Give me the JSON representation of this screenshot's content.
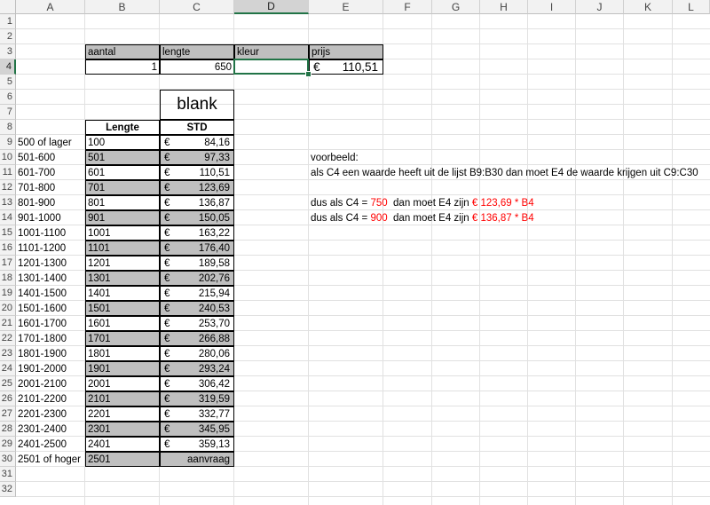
{
  "columns": [
    "A",
    "B",
    "C",
    "D",
    "E",
    "F",
    "G",
    "H",
    "I",
    "J",
    "K",
    "L"
  ],
  "selected_column": "D",
  "selected_row": 4,
  "header_row": {
    "aantal": "aantal",
    "lengte": "lengte",
    "kleur": "kleur",
    "prijs": "prijs"
  },
  "input_row": {
    "aantal_value": "1",
    "lengte_value": "650",
    "kleur_value": "",
    "prijs_currency": "€",
    "prijs_value": "110,51"
  },
  "table": {
    "blank_label": "blank",
    "lengte_header": "Lengte",
    "std_header": "STD",
    "currency": "€",
    "rows": [
      {
        "range": "500 of lager",
        "lengte": "100",
        "std": "84,16"
      },
      {
        "range": "501-600",
        "lengte": "501",
        "std": "97,33"
      },
      {
        "range": "601-700",
        "lengte": "601",
        "std": "110,51"
      },
      {
        "range": "701-800",
        "lengte": "701",
        "std": "123,69"
      },
      {
        "range": "801-900",
        "lengte": "801",
        "std": "136,87"
      },
      {
        "range": "901-1000",
        "lengte": "901",
        "std": "150,05"
      },
      {
        "range": "1001-1100",
        "lengte": "1001",
        "std": "163,22"
      },
      {
        "range": "1101-1200",
        "lengte": "1101",
        "std": "176,40"
      },
      {
        "range": "1201-1300",
        "lengte": "1201",
        "std": "189,58"
      },
      {
        "range": "1301-1400",
        "lengte": "1301",
        "std": "202,76"
      },
      {
        "range": "1401-1500",
        "lengte": "1401",
        "std": "215,94"
      },
      {
        "range": "1501-1600",
        "lengte": "1501",
        "std": "240,53"
      },
      {
        "range": "1601-1700",
        "lengte": "1601",
        "std": "253,70"
      },
      {
        "range": "1701-1800",
        "lengte": "1701",
        "std": "266,88"
      },
      {
        "range": "1801-1900",
        "lengte": "1801",
        "std": "280,06"
      },
      {
        "range": "1901-2000",
        "lengte": "1901",
        "std": "293,24"
      },
      {
        "range": "2001-2100",
        "lengte": "2001",
        "std": "306,42"
      },
      {
        "range": "2101-2200",
        "lengte": "2101",
        "std": "319,59"
      },
      {
        "range": "2201-2300",
        "lengte": "2201",
        "std": "332,77"
      },
      {
        "range": "2301-2400",
        "lengte": "2301",
        "std": "345,95"
      },
      {
        "range": "2401-2500",
        "lengte": "2401",
        "std": "359,13"
      },
      {
        "range": "2501 of hoger",
        "lengte": "2501",
        "std": "aanvraag"
      }
    ]
  },
  "notes": {
    "voorbeeld": "voorbeeld:",
    "line1": "als C4 een waarde heeft uit de lijst B9:B30 dan moet E4 de waarde  krijgen uit C9:C30",
    "line2_pre": "dus als C4 = ",
    "line2_val": "750",
    "line2_mid": "  dan moet E4 zijn ",
    "line2_res": "€ 123,69 * B4",
    "line3_pre": "dus als C4 = ",
    "line3_val": "900",
    "line3_mid": "  dan moet E4 zijn ",
    "line3_res": "€ 136,87 * B4"
  },
  "colors": {
    "grid": "#e1e1e1",
    "header_bg": "#f2f2f2",
    "selection": "#217346",
    "grey_fill": "#bfbfbf",
    "highlight_red": "#ff0000"
  }
}
